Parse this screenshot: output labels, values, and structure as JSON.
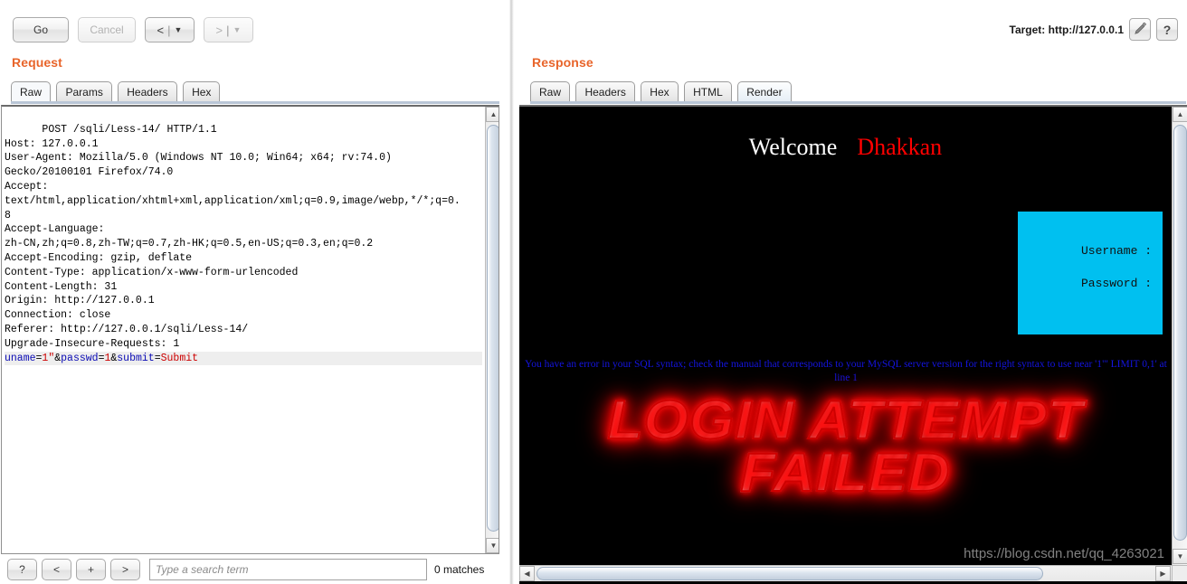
{
  "toolbar": {
    "go_label": "Go",
    "cancel_label": "Cancel",
    "back_label": "<",
    "back_caret": "▼",
    "forward_label": ">",
    "forward_caret": "▼",
    "separator": "|",
    "target_label": "Target: http://127.0.0.1",
    "edit_icon": "pencil-icon",
    "help_label": "?"
  },
  "request": {
    "title": "Request",
    "tabs": [
      {
        "label": "Raw",
        "active": true
      },
      {
        "label": "Params",
        "active": false
      },
      {
        "label": "Headers",
        "active": false
      },
      {
        "label": "Hex",
        "active": false
      }
    ],
    "raw_headers": "POST /sqli/Less-14/ HTTP/1.1\nHost: 127.0.0.1\nUser-Agent: Mozilla/5.0 (Windows NT 10.0; Win64; x64; rv:74.0)\nGecko/20100101 Firefox/74.0\nAccept:\ntext/html,application/xhtml+xml,application/xml;q=0.9,image/webp,*/*;q=0.\n8\nAccept-Language:\nzh-CN,zh;q=0.8,zh-TW;q=0.7,zh-HK;q=0.5,en-US;q=0.3,en;q=0.2\nAccept-Encoding: gzip, deflate\nContent-Type: application/x-www-form-urlencoded\nContent-Length: 31\nOrigin: http://127.0.0.1\nConnection: close\nReferer: http://127.0.0.1/sqli/Less-14/\nUpgrade-Insecure-Requests: 1\n",
    "body": {
      "param1_name": "uname",
      "param1_value": "1\"",
      "param2_name": "passwd",
      "param2_value": "1",
      "param3_name": "submit",
      "param3_value": "Submit",
      "eq": "=",
      "amp": "&",
      "full": "uname=1\"&passwd=1&submit=Submit"
    },
    "search_bar": {
      "help_label": "?",
      "prev_label": "<",
      "add_label": "+",
      "next_label": ">",
      "placeholder": "Type a search term",
      "value": "",
      "match_count": "0 matches"
    },
    "scrollbar": {
      "up_arrow": "▲",
      "down_arrow": "▼"
    }
  },
  "response": {
    "title": "Response",
    "tabs": [
      {
        "label": "Raw",
        "active": false
      },
      {
        "label": "Headers",
        "active": false
      },
      {
        "label": "Hex",
        "active": false
      },
      {
        "label": "HTML",
        "active": false
      },
      {
        "label": "Render",
        "active": true
      }
    ],
    "rendered_page": {
      "welcome_text": "Welcome",
      "user_name": "Dhakkan",
      "login_box": {
        "username_label": "Username :",
        "password_label": "Password :",
        "background_color": "#00c0f0"
      },
      "sql_error": "You have an error in your SQL syntax; check the manual that corresponds to your MySQL server version for the right syntax to use near '1\"' LIMIT 0,1' at line 1",
      "failure_line1": "LOGIN ATTEMPT",
      "failure_line2": "FAILED",
      "watermark": "https://blog.csdn.net/qq_4263021"
    },
    "scrollbar": {
      "up_arrow": "▲",
      "down_arrow": "▼",
      "left_arrow": "◀",
      "right_arrow": "▶"
    }
  },
  "colors": {
    "panel_title": "#e8642a",
    "param_name": "#0a0ab4",
    "param_value": "#cc0000",
    "sql_error": "#1414e0",
    "login_box": "#00c0f0",
    "fail_glow": "#ff0000"
  }
}
